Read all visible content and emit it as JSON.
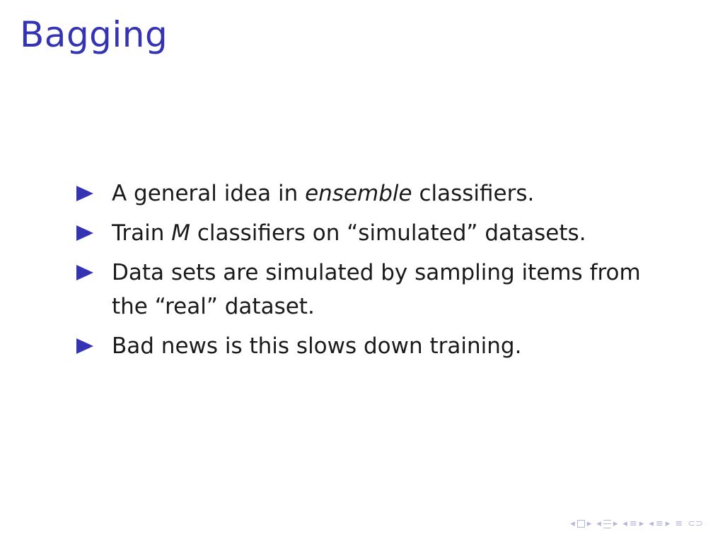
{
  "slide": {
    "title": "Bagging",
    "bullets": [
      {
        "parts": [
          {
            "text": "A general idea in "
          },
          {
            "text": "ensemble",
            "italic": true
          },
          {
            "text": " classifiers."
          }
        ]
      },
      {
        "parts": [
          {
            "text": "Train "
          },
          {
            "text": "M",
            "italic": true
          },
          {
            "text": " classifiers on “simulated” datasets."
          }
        ]
      },
      {
        "parts": [
          {
            "text": "Data sets are simulated by sampling items from the “real” dataset."
          }
        ]
      },
      {
        "parts": [
          {
            "text": "Bad news is this slows down training."
          }
        ]
      }
    ]
  },
  "navigation": {
    "left_arrow": "◂",
    "right_arrow": "▸",
    "align_symbol": "≡",
    "search_symbol": "⊂⊃"
  },
  "colors": {
    "accent": "#3333b3",
    "text": "#1a1a1a",
    "nav": "#b5b5d8"
  }
}
